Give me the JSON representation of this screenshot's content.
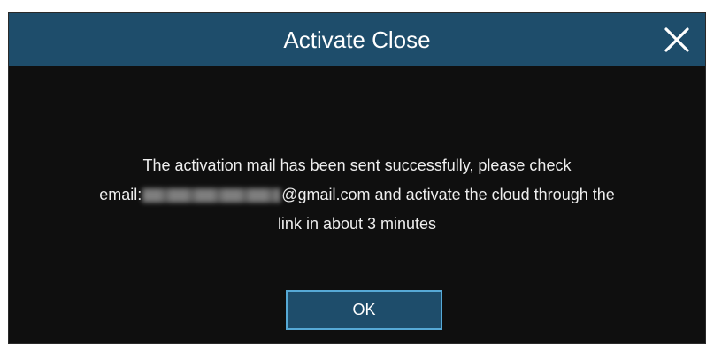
{
  "dialog": {
    "title": "Activate Close",
    "close_icon": "close-icon",
    "message": {
      "line1": "The activation mail has been sent successfully, please check",
      "email_prefix": "email:",
      "email_domain": "@gmail.com",
      "line2_rest": " and activate the cloud through the",
      "line3": "link in about 3 minutes"
    },
    "ok_label": "OK"
  },
  "colors": {
    "titlebar": "#1e4d6b",
    "background": "#0f0f0f",
    "button_border": "#56a9d6",
    "text": "#ffffff"
  }
}
